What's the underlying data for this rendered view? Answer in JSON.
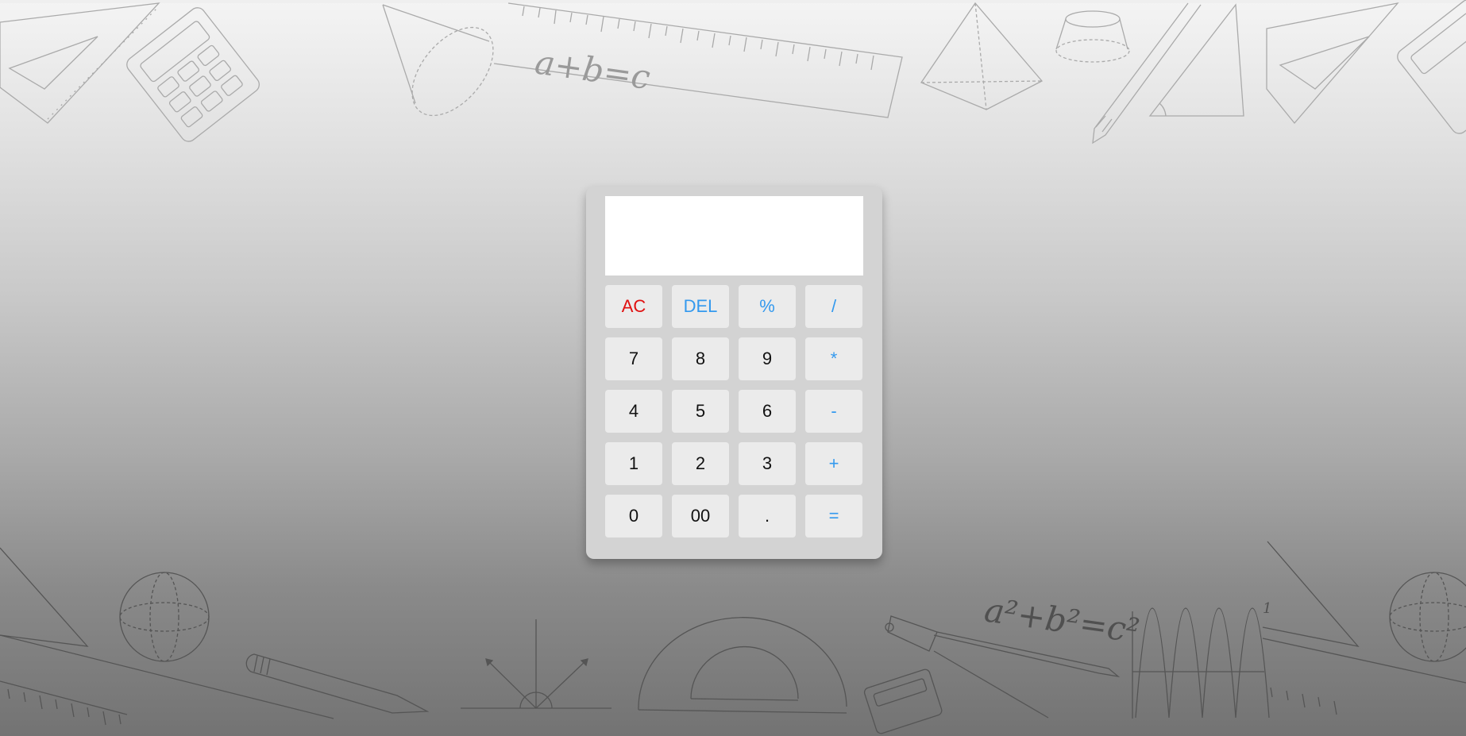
{
  "calculator": {
    "display_value": "",
    "keys": [
      {
        "label": "AC",
        "kind": "clear"
      },
      {
        "label": "DEL",
        "kind": "op"
      },
      {
        "label": "%",
        "kind": "op"
      },
      {
        "label": "/",
        "kind": "op"
      },
      {
        "label": "7",
        "kind": "digit"
      },
      {
        "label": "8",
        "kind": "digit"
      },
      {
        "label": "9",
        "kind": "digit"
      },
      {
        "label": "*",
        "kind": "op"
      },
      {
        "label": "4",
        "kind": "digit"
      },
      {
        "label": "5",
        "kind": "digit"
      },
      {
        "label": "6",
        "kind": "digit"
      },
      {
        "label": "-",
        "kind": "op"
      },
      {
        "label": "1",
        "kind": "digit"
      },
      {
        "label": "2",
        "kind": "digit"
      },
      {
        "label": "3",
        "kind": "digit"
      },
      {
        "label": "+",
        "kind": "op"
      },
      {
        "label": "0",
        "kind": "digit"
      },
      {
        "label": "00",
        "kind": "digit"
      },
      {
        "label": ".",
        "kind": "digit"
      },
      {
        "label": "=",
        "kind": "op"
      }
    ]
  },
  "background": {
    "formula_top": "a+b=c",
    "formula_bottom": "a²+b²=c²",
    "bottom_label_1": "1",
    "colors": {
      "clear_key": "#e01010",
      "operator_key": "#3399ee",
      "digit_key": "#111111"
    }
  }
}
